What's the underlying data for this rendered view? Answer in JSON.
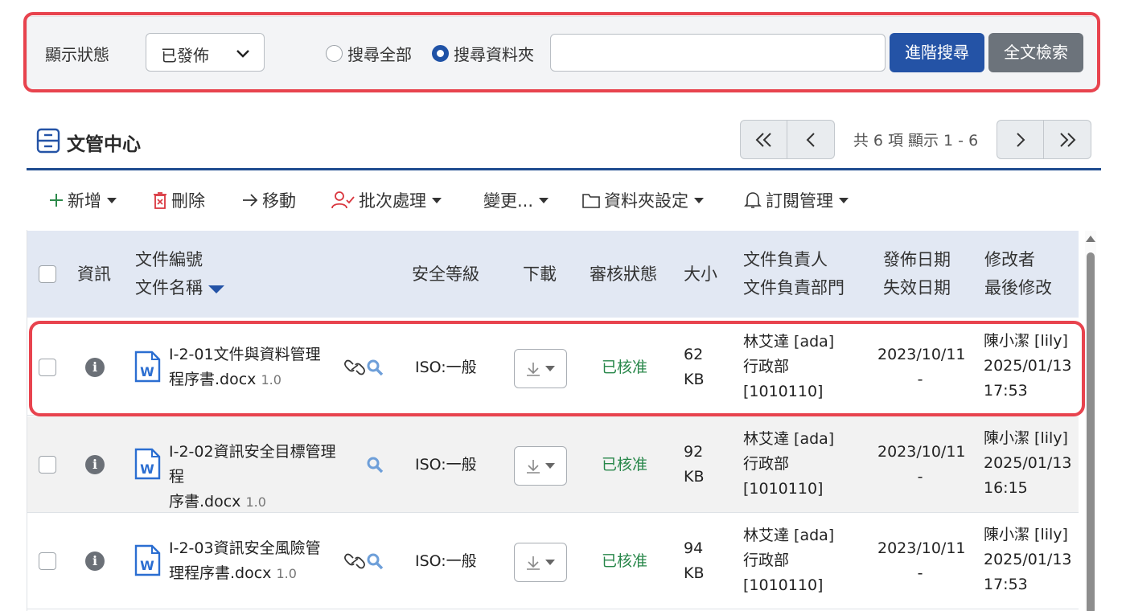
{
  "search": {
    "status_label": "顯示狀態",
    "status_value": "已發佈",
    "radio_all": "搜尋全部",
    "radio_folder": "搜尋資料夾",
    "selected_radio": "folder",
    "query": "",
    "advanced_label": "進階搜尋",
    "fulltext_label": "全文檢索"
  },
  "page": {
    "title": "文管中心"
  },
  "pager": {
    "info": "共 6 項 顯示 1 - 6"
  },
  "toolbar": {
    "add": "新增",
    "delete": "刪除",
    "move": "移動",
    "batch": "批次處理",
    "change": "變更...",
    "folder_settings": "資料夾設定",
    "subscribe": "訂閱管理"
  },
  "table": {
    "headers": {
      "info": "資訊",
      "doc_no": "文件編號",
      "doc_name": "文件名稱",
      "security": "安全等級",
      "download": "下載",
      "review": "審核狀態",
      "size": "大小",
      "owner": "文件負責人",
      "owner_dept": "文件負責部門",
      "publish": "發佈日期",
      "expire": "失效日期",
      "modifier": "修改者",
      "last_modified": "最後修改"
    },
    "rows": [
      {
        "name_line1": "I-2-01文件與資料管理",
        "name_line2": "程序書.docx",
        "version": "1.0",
        "security": "ISO:一般",
        "review": "已核准",
        "size_num": "62",
        "size_unit": "KB",
        "owner": "林艾達 [ada]",
        "dept1": "行政部",
        "dept2": "[1010110]",
        "publish": "2023/10/11",
        "expire": "-",
        "modifier": "陳小潔 [lily]",
        "mod_date": "2025/01/13",
        "mod_time": "17:53",
        "has_link": true
      },
      {
        "name_line1": "I-2-02資訊安全目標管理程",
        "name_line2": "序書.docx",
        "version": "1.0",
        "security": "ISO:一般",
        "review": "已核准",
        "size_num": "92",
        "size_unit": "KB",
        "owner": "林艾達 [ada]",
        "dept1": "行政部",
        "dept2": "[1010110]",
        "publish": "2023/10/11",
        "expire": "-",
        "modifier": "陳小潔 [lily]",
        "mod_date": "2025/01/13",
        "mod_time": "16:15",
        "has_link": false
      },
      {
        "name_line1": "I-2-03資訊安全風險管",
        "name_line2": "理程序書.docx",
        "version": "1.0",
        "security": "ISO:一般",
        "review": "已核准",
        "size_num": "94",
        "size_unit": "KB",
        "owner": "林艾達 [ada]",
        "dept1": "行政部",
        "dept2": "[1010110]",
        "publish": "2023/10/11",
        "expire": "-",
        "modifier": "陳小潔 [lily]",
        "mod_date": "2025/01/13",
        "mod_time": "17:53",
        "has_link": true
      }
    ]
  },
  "colors": {
    "primary": "#2453a6",
    "secondary": "#6c737b",
    "approved": "#28874a",
    "highlight": "#e8434e",
    "header_bg": "#e2e8f3"
  }
}
